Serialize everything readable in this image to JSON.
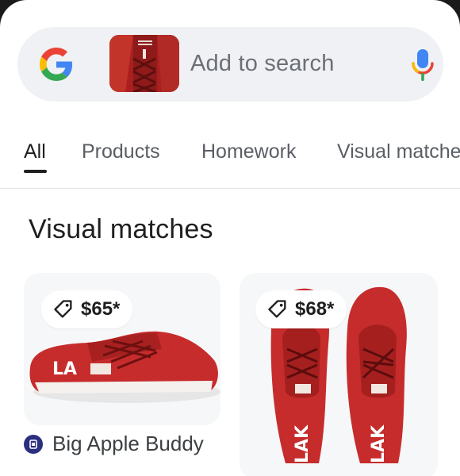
{
  "search": {
    "placeholder": "Add to search"
  },
  "tabs": [
    {
      "label": "All",
      "active": true
    },
    {
      "label": "Products"
    },
    {
      "label": "Homework"
    },
    {
      "label": "Visual matches"
    }
  ],
  "section": {
    "title": "Visual matches"
  },
  "results": [
    {
      "price": "$65*",
      "source": "Big Apple Buddy"
    },
    {
      "price": "$68*"
    }
  ],
  "colors": {
    "shoe_red": "#c62c2c",
    "search_bg": "#eff1f4"
  },
  "icons": {
    "logo": "google-g-icon",
    "mic": "mic-icon",
    "tag": "price-tag-icon",
    "source": "store-icon"
  }
}
